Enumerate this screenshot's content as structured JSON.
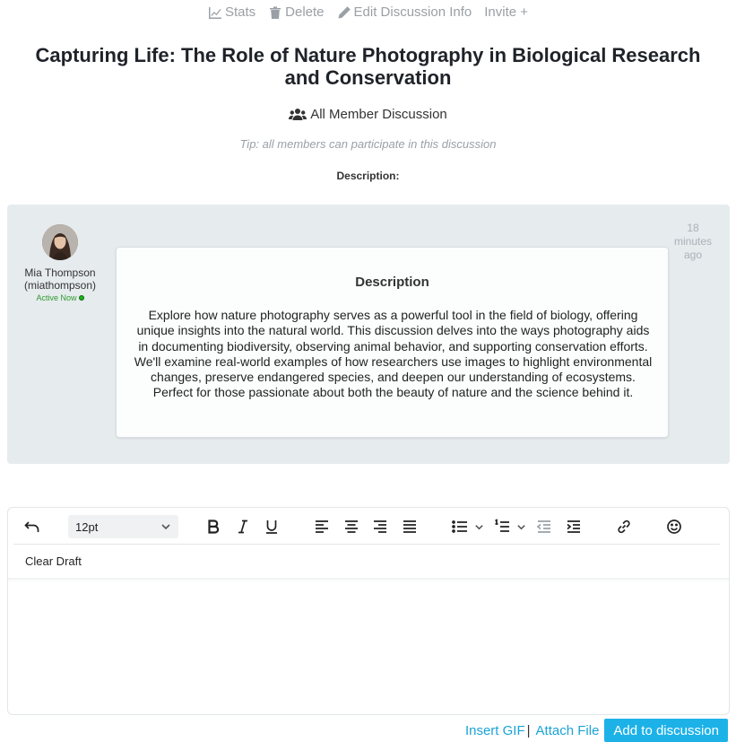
{
  "top_actions": {
    "stats": "Stats",
    "delete": "Delete",
    "edit": "Edit Discussion Info",
    "invite": "Invite +"
  },
  "discussion": {
    "title": "Capturing Life: The Role of Nature Photography in Biological Research and Conservation",
    "type": "All Member Discussion",
    "tip": "Tip: all members can participate in this discussion",
    "description_label": "Description:"
  },
  "post": {
    "author_name": "Mia Thompson",
    "author_handle": "(miathompson)",
    "status": "Active Now",
    "timestamp": "18 minutes ago",
    "card_title": "Description",
    "body": "Explore how nature photography serves as a powerful tool in the field of biology, offering unique insights into the natural world. This discussion delves into the ways photography aids in documenting biodiversity, observing animal behavior, and supporting conservation efforts. We'll examine real-world examples of how researchers use images to highlight environmental changes, preserve endangered species, and deepen our understanding of ecosystems. Perfect for those passionate about both the beauty of nature and the science behind it."
  },
  "editor": {
    "font_size": "12pt",
    "clear_draft": "Clear Draft"
  },
  "bottom_actions": {
    "insert_gif": "Insert GIF",
    "separator": "|",
    "attach_file": "Attach File",
    "submit": "Add to discussion"
  },
  "colors": {
    "accent": "#1cb2e8",
    "link": "#1aa3d8",
    "panel": "#e6ebee",
    "muted": "#9aa0a6",
    "active": "#2e9a2e"
  }
}
